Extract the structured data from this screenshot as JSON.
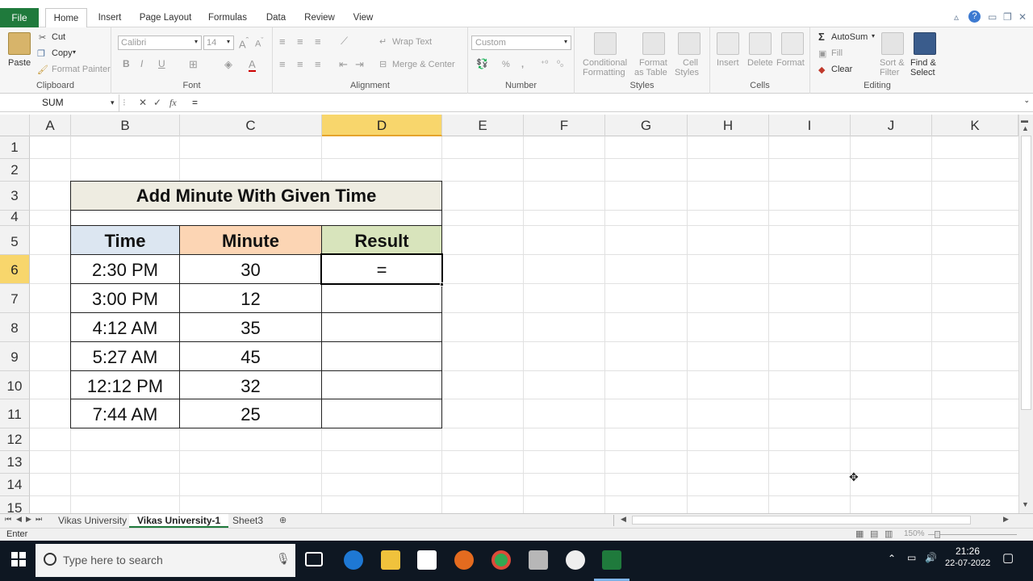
{
  "ribbon_tabs": [
    "File",
    "Home",
    "Insert",
    "Page Layout",
    "Formulas",
    "Data",
    "Review",
    "View"
  ],
  "clipboard": {
    "paste": "Paste",
    "cut": "Cut",
    "copy": "Copy",
    "format_painter": "Format Painter",
    "label": "Clipboard"
  },
  "font": {
    "name": "Calibri",
    "size": "14",
    "label": "Font",
    "bold": "B",
    "italic": "I",
    "underline": "U",
    "font_color": "A"
  },
  "alignment": {
    "wrap_text": "Wrap Text",
    "merge_center": "Merge & Center",
    "label": "Alignment"
  },
  "number": {
    "format": "Custom",
    "percent": "%",
    "comma": ",",
    "label": "Number"
  },
  "styles": {
    "conditional": "Conditional",
    "formatting": "Formatting",
    "format": "Format",
    "as_table": "as Table",
    "cell": "Cell",
    "styles": "Styles",
    "label": "Styles"
  },
  "cells": {
    "insert": "Insert",
    "delete": "Delete",
    "format": "Format",
    "label": "Cells"
  },
  "editing": {
    "autosum": "AutoSum",
    "fill": "Fill",
    "clear": "Clear",
    "sort": "Sort &",
    "filter": "Filter",
    "find": "Find &",
    "select": "Select",
    "label": "Editing",
    "sigma": "Σ"
  },
  "formula_bar": {
    "name_box": "SUM",
    "fx": "fx",
    "content": "="
  },
  "columns": [
    "A",
    "B",
    "C",
    "D",
    "E",
    "F",
    "G",
    "H",
    "I",
    "J",
    "K"
  ],
  "rows": [
    "1",
    "2",
    "3",
    "4",
    "5",
    "6",
    "7",
    "8",
    "9",
    "10",
    "11",
    "12",
    "13",
    "14",
    "15"
  ],
  "table": {
    "title": "Add Minute With Given Time",
    "headers": [
      "Time",
      "Minute",
      "Result"
    ],
    "rows": [
      [
        "2:30 PM",
        "30",
        "="
      ],
      [
        "3:00 PM",
        "12",
        ""
      ],
      [
        "4:12 AM",
        "35",
        ""
      ],
      [
        "5:27 AM",
        "45",
        ""
      ],
      [
        "12:12 PM",
        "32",
        ""
      ],
      [
        "7:44 AM",
        "25",
        ""
      ]
    ]
  },
  "sheets": [
    "Vikas University",
    "Vikas University-1",
    "Sheet3"
  ],
  "status": {
    "mode": "Enter",
    "zoom": "150%"
  },
  "taskbar": {
    "search_placeholder": "Type here to search",
    "time": "21:26",
    "date": "22-07-2022"
  },
  "colors": {
    "title_fill": "#eeece1",
    "time_fill": "#dce6f1",
    "minute_fill": "#fcd5b4",
    "result_fill": "#d8e4bc",
    "excel_green": "#1f7a3c",
    "selection": "#f8d66c"
  }
}
